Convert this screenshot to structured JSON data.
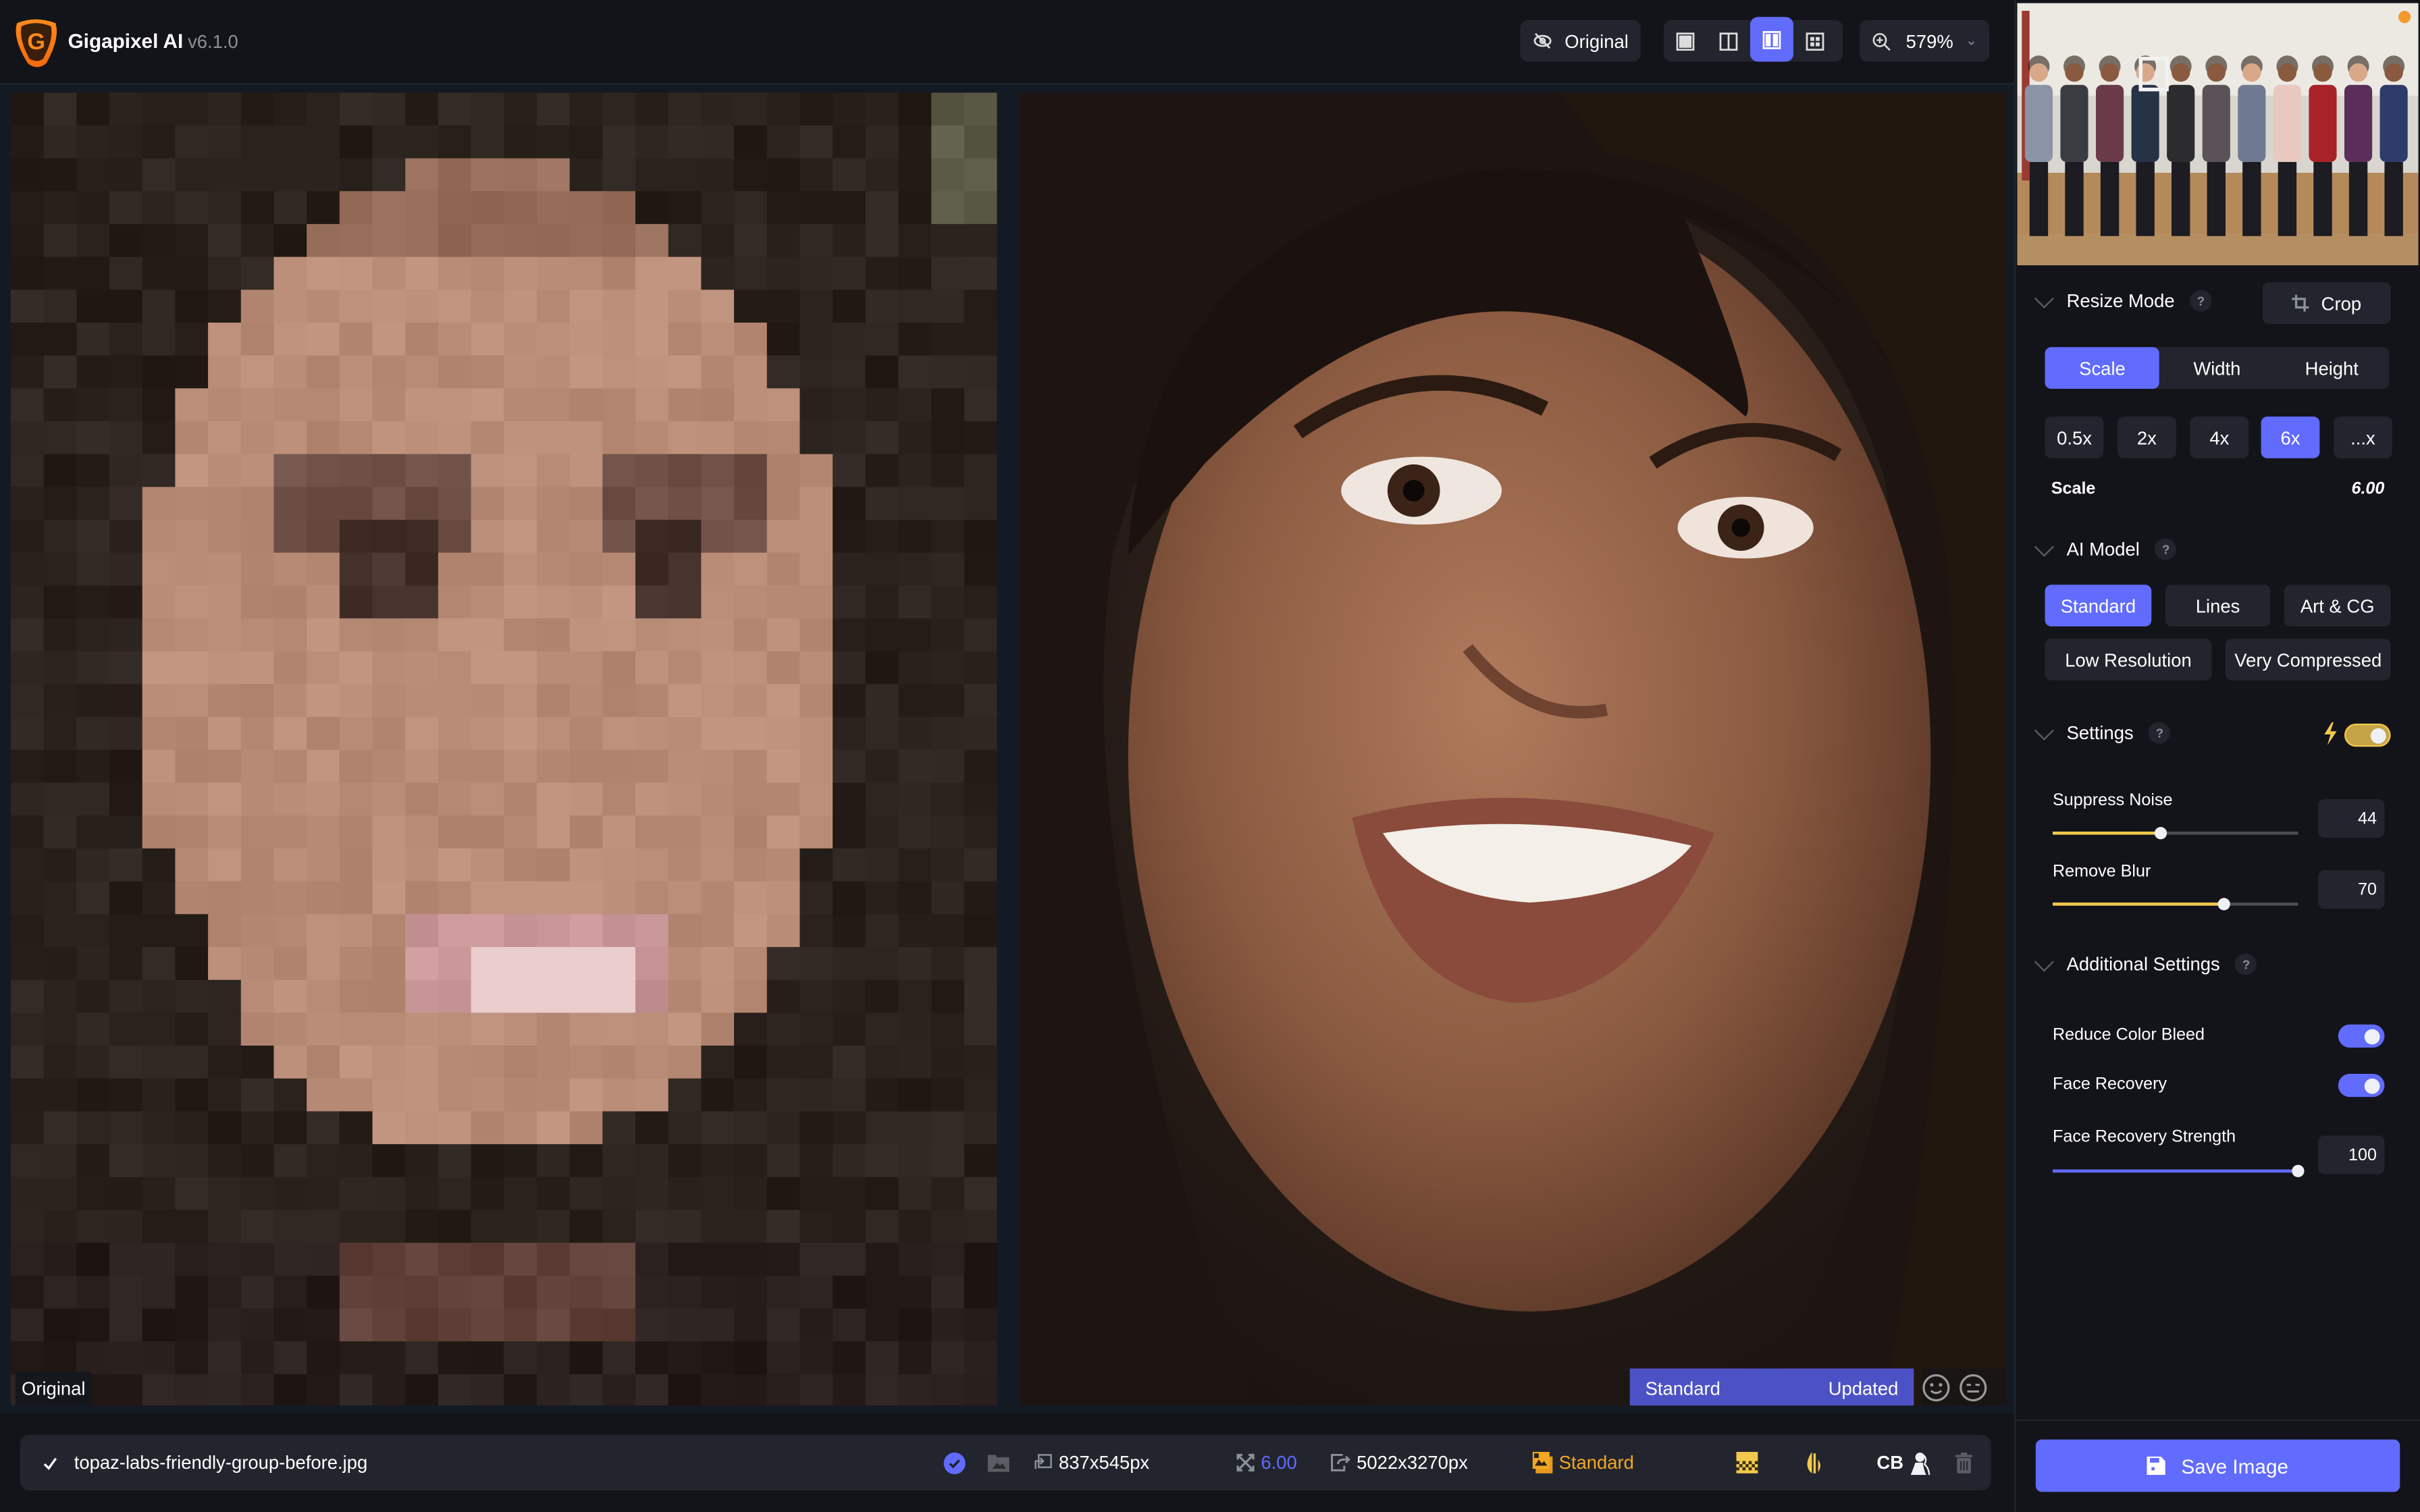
{
  "app": {
    "title": "Gigapixel AI",
    "version": "v6.1.0"
  },
  "toolbar": {
    "original_label": "Original",
    "view_modes": [
      "single",
      "split",
      "side-by-side",
      "grid"
    ],
    "active_view": "side-by-side",
    "zoom_level": "579%"
  },
  "viewer": {
    "left_label": "Original",
    "model_status": {
      "model": "Standard",
      "state": "Updated",
      "progress": 1.0
    },
    "feedback": [
      "smile",
      "neutral"
    ]
  },
  "file": {
    "name": "topaz-labs-friendly-group-before.jpg",
    "input_size": "837x545px",
    "scale": "6.00",
    "output_size": "5022x3270px",
    "model": "Standard",
    "cb_label": "CB"
  },
  "panel": {
    "resize_mode": {
      "title": "Resize Mode",
      "help": "?",
      "crop_label": "Crop",
      "modes": [
        {
          "label": "Scale",
          "active": true
        },
        {
          "label": "Width",
          "active": false
        },
        {
          "label": "Height",
          "active": false
        }
      ],
      "presets": [
        {
          "label": "0.5x",
          "active": false
        },
        {
          "label": "2x",
          "active": false
        },
        {
          "label": "4x",
          "active": false
        },
        {
          "label": "6x",
          "active": true
        },
        {
          "label": "...x",
          "active": false
        }
      ],
      "scale_label": "Scale",
      "scale_value": "6.00"
    },
    "ai_model": {
      "title": "AI Model",
      "help": "?",
      "models": [
        {
          "label": "Standard",
          "active": true
        },
        {
          "label": "Lines",
          "active": false
        },
        {
          "label": "Art & CG",
          "active": false
        },
        {
          "label": "Low Resolution",
          "active": false
        },
        {
          "label": "Very Compressed",
          "active": false
        }
      ]
    },
    "settings": {
      "title": "Settings",
      "help": "?",
      "auto_enabled": true,
      "suppress_noise": {
        "label": "Suppress Noise",
        "value": "44",
        "fraction": 0.44
      },
      "remove_blur": {
        "label": "Remove Blur",
        "value": "70",
        "fraction": 0.7
      }
    },
    "additional": {
      "title": "Additional Settings",
      "help": "?",
      "reduce_color_bleed": {
        "label": "Reduce Color Bleed",
        "on": true
      },
      "face_recovery": {
        "label": "Face Recovery",
        "on": true
      },
      "face_recovery_strength": {
        "label": "Face Recovery Strength",
        "value": "100",
        "fraction": 1.0
      }
    },
    "save_label": "Save Image"
  },
  "colors": {
    "accent": "#616bfe",
    "warning": "#f5a623",
    "yellow": "#f2c94c",
    "success": "#27ae60",
    "bg": "#131419",
    "surface": "#22252d"
  }
}
